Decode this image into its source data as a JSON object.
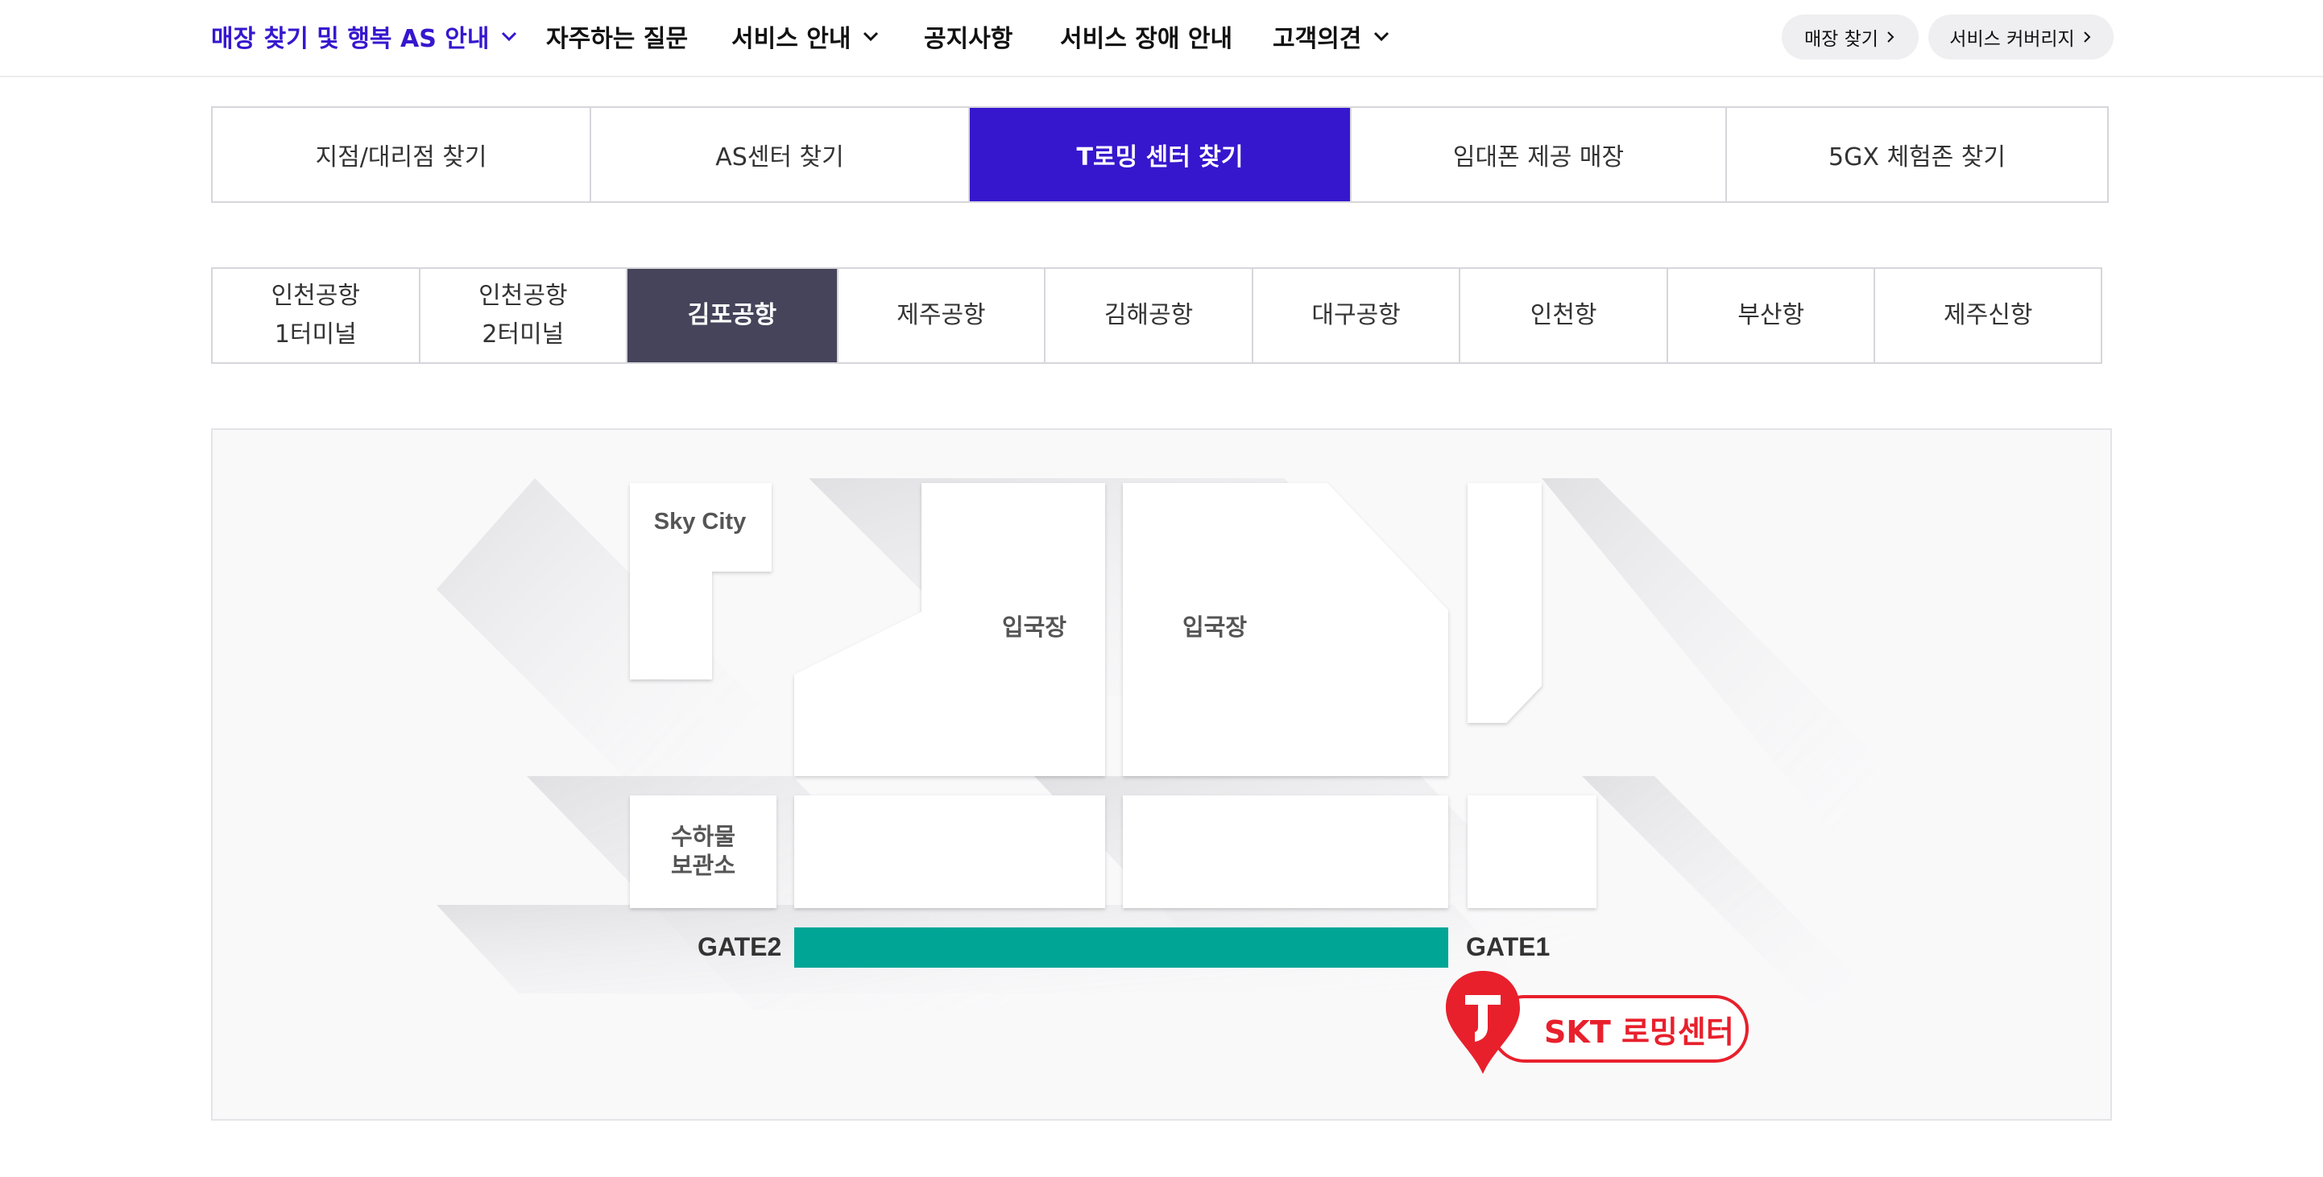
{
  "topnav": {
    "items": [
      {
        "label": "매장 찾기 및 행복 AS 안내",
        "dropdown": true,
        "active": true
      },
      {
        "label": "자주하는 질문",
        "dropdown": false,
        "active": false
      },
      {
        "label": "서비스 안내",
        "dropdown": true,
        "active": false
      },
      {
        "label": "공지사항",
        "dropdown": false,
        "active": false
      },
      {
        "label": "서비스 장애 안내",
        "dropdown": false,
        "active": false
      },
      {
        "label": "고객의견",
        "dropdown": true,
        "active": false
      }
    ],
    "quick_links": [
      {
        "label": "매장 찾기"
      },
      {
        "label": "서비스 커버리지"
      }
    ]
  },
  "main_tabs": [
    {
      "label": "지점/대리점 찾기",
      "active": false
    },
    {
      "label": "AS센터 찾기",
      "active": false
    },
    {
      "label": "T로밍 센터 찾기",
      "active": true
    },
    {
      "label": "임대폰 제공 매장",
      "active": false
    },
    {
      "label": "5GX 체험존 찾기",
      "active": false
    }
  ],
  "airport_tabs": [
    {
      "label_line1": "인천공항",
      "label_line2": "1터미널",
      "active": false
    },
    {
      "label_line1": "인천공항",
      "label_line2": "2터미널",
      "active": false
    },
    {
      "label_line1": "김포공항",
      "label_line2": "",
      "active": true
    },
    {
      "label_line1": "제주공항",
      "label_line2": "",
      "active": false
    },
    {
      "label_line1": "김해공항",
      "label_line2": "",
      "active": false
    },
    {
      "label_line1": "대구공항",
      "label_line2": "",
      "active": false
    },
    {
      "label_line1": "인천항",
      "label_line2": "",
      "active": false
    },
    {
      "label_line1": "부산항",
      "label_line2": "",
      "active": false
    },
    {
      "label_line1": "제주신항",
      "label_line2": "",
      "active": false
    }
  ],
  "map": {
    "sky_city": "Sky City",
    "arrival_left": "입국장",
    "arrival_right": "입국장",
    "baggage_line1": "수하물",
    "baggage_line2": "보관소",
    "gate2": "GATE2",
    "gate1": "GATE1",
    "marker_label": "SKT 로밍센터"
  },
  "colors": {
    "accent": "#3617ce",
    "active_airport_tab": "#45445a",
    "corridor": "#00a596",
    "skt_red": "#e8202c"
  },
  "icons": {
    "dropdown": "chevron-down-icon",
    "link": "chevron-right-icon",
    "marker": "t-logo-pin-icon"
  }
}
